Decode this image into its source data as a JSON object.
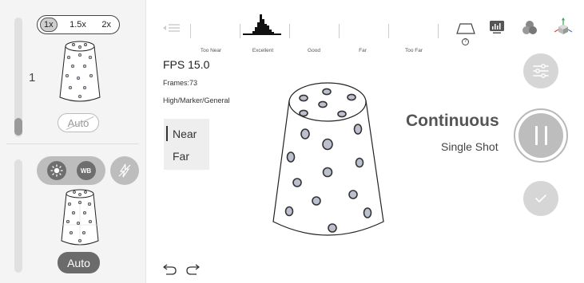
{
  "zoom": {
    "options": [
      "1x",
      "1.5x",
      "2x"
    ],
    "selected": "1x",
    "level": "1"
  },
  "focus": {
    "auto_label": "Auto"
  },
  "camera": {
    "wb_label": "WB",
    "auto_label": "Auto"
  },
  "quality": {
    "labels": [
      "Too Near",
      "Excellent",
      "Good",
      "Far",
      "Too Far"
    ]
  },
  "info": {
    "fps": "FPS 15.0",
    "frames": "Frames:73",
    "mode": "High/Marker/General"
  },
  "range": {
    "near": "Near",
    "far": "Far"
  },
  "capture": {
    "continuous": "Continuous",
    "single_shot": "Single Shot"
  },
  "help_glyph": "?",
  "icons": [
    "menu-icon",
    "perspective-icon",
    "histogram-icon",
    "color-circles-icon",
    "axes-icon",
    "settings-icon",
    "pause-icon",
    "check-icon",
    "undo-icon",
    "redo-icon",
    "brightness-icon",
    "flash-off-icon"
  ],
  "colors": {
    "accent_gray": "#6b6b6b",
    "marker_fill": "#bcc0ce"
  }
}
